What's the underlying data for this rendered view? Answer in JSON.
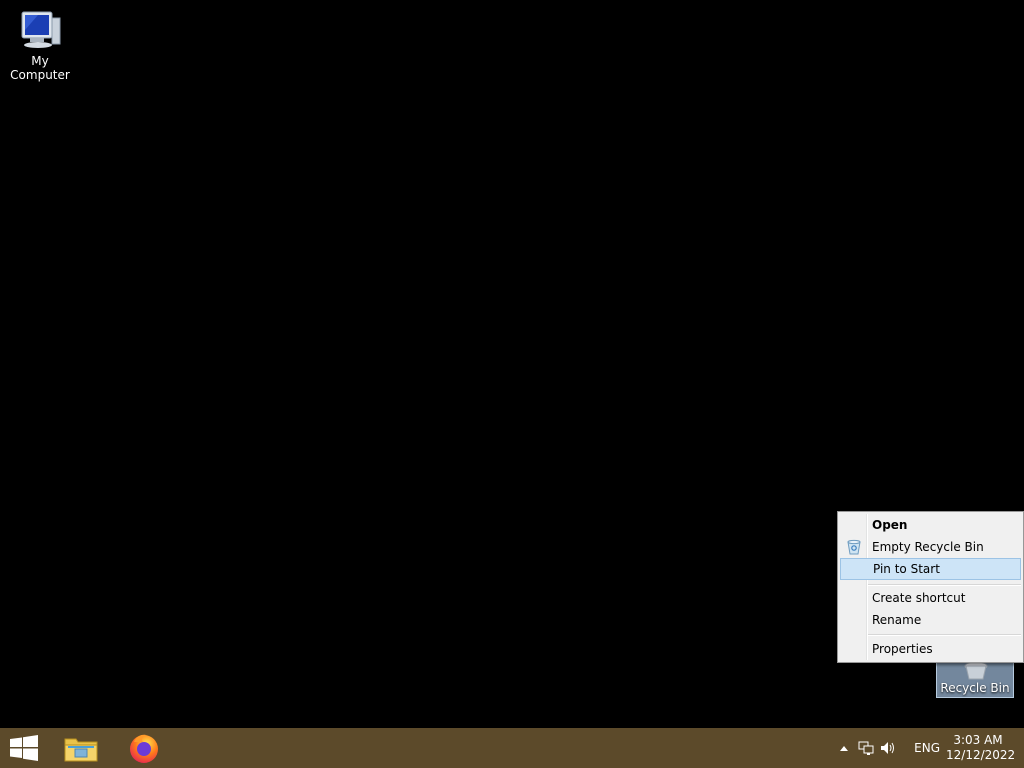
{
  "desktop": {
    "icons": [
      {
        "label": "My Computer",
        "icon": "computer-icon"
      },
      {
        "label": "Recycle Bin",
        "icon": "recycle-bin-icon"
      }
    ]
  },
  "context_menu": {
    "items": [
      {
        "label": "Open",
        "bold": true
      },
      {
        "label": "Empty Recycle Bin",
        "icon": "recycle-bin-small-icon"
      },
      {
        "label": "Pin to Start",
        "highlighted": true
      },
      {
        "label": "Create shortcut"
      },
      {
        "label": "Rename"
      },
      {
        "label": "Properties"
      }
    ]
  },
  "taskbar": {
    "color": "#5c4a2a",
    "pinned": [
      {
        "icon": "windows-start-icon"
      },
      {
        "icon": "file-explorer-icon"
      },
      {
        "icon": "firefox-icon"
      }
    ],
    "tray": {
      "language": "ENG",
      "time": "3:03 AM",
      "date": "12/12/2022",
      "icons": [
        "show-hidden-icons-chevron",
        "network-icon",
        "volume-icon"
      ]
    }
  }
}
